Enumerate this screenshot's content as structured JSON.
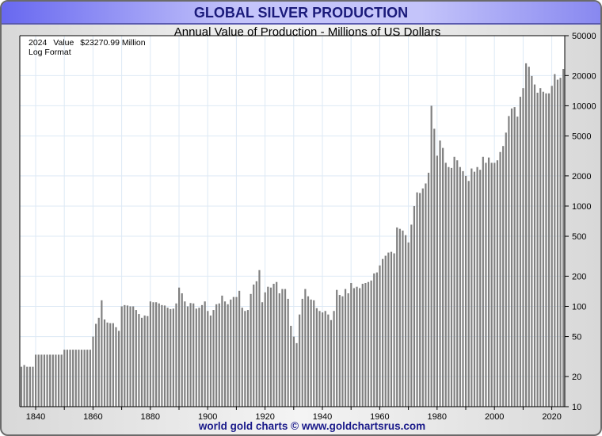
{
  "title": "GLOBAL SILVER PRODUCTION",
  "footer": "world gold charts © www.goldchartsrus.com",
  "colors": {
    "bar": "#808080",
    "grid": "#dde9f5",
    "title": "#1a1a7a",
    "footer": "#1a1a8a"
  },
  "chart_data": {
    "type": "bar",
    "title": "Annual Value of Production - Millions of US Dollars",
    "annotation": {
      "year_label": "2024",
      "value_label": "Value",
      "value_text": "$23270.99 Million",
      "scale_note": "Log Format"
    },
    "xlabel": "",
    "ylabel": "",
    "yscale": "log",
    "ylim": [
      10,
      50000
    ],
    "xlim": [
      1835,
      2024
    ],
    "grid": true,
    "y_ticks": [
      10,
      20,
      50,
      100,
      200,
      500,
      1000,
      2000,
      5000,
      10000,
      20000,
      50000
    ],
    "x_ticks": [
      1840,
      1860,
      1880,
      1900,
      1920,
      1940,
      1960,
      1980,
      2000,
      2020
    ],
    "x_start": 1835,
    "values": [
      25,
      26,
      25,
      25,
      25,
      33,
      33,
      33,
      33,
      33,
      33,
      33,
      33,
      33,
      33,
      37,
      37,
      37,
      37,
      37,
      37,
      37,
      37,
      37,
      37,
      50,
      67,
      77,
      115,
      74,
      69,
      68,
      68,
      62,
      57,
      100,
      103,
      102,
      100,
      100,
      92,
      84,
      77,
      81,
      80,
      112,
      110,
      110,
      107,
      103,
      102,
      97,
      94,
      95,
      107,
      154,
      135,
      112,
      100,
      108,
      107,
      95,
      97,
      103,
      112,
      90,
      81,
      92,
      105,
      107,
      128,
      112,
      105,
      117,
      124,
      124,
      143,
      97,
      90,
      92,
      133,
      165,
      178,
      230,
      110,
      138,
      157,
      154,
      168,
      175,
      135,
      149,
      149,
      119,
      64,
      50,
      43,
      83,
      119,
      149,
      126,
      117,
      115,
      96,
      90,
      87,
      90,
      83,
      73,
      90,
      146,
      130,
      126,
      149,
      135,
      171,
      152,
      157,
      152,
      168,
      171,
      175,
      181,
      213,
      218,
      256,
      297,
      320,
      344,
      350,
      338,
      612,
      593,
      570,
      513,
      434,
      653,
      1000,
      1370,
      1350,
      1500,
      1680,
      2150,
      10000,
      5900,
      3180,
      4500,
      3800,
      2700,
      2450,
      2400,
      3100,
      2860,
      2450,
      2230,
      2000,
      1780,
      2370,
      2200,
      2450,
      2300,
      3100,
      2700,
      3050,
      2700,
      2700,
      2860,
      3460,
      3970,
      5400,
      7900,
      9400,
      9700,
      7800,
      12300,
      15000,
      26500,
      24500,
      19800,
      16300,
      13500,
      15000,
      13800,
      13300,
      13300,
      15800,
      20700,
      18200,
      19000,
      23270.99
    ]
  }
}
